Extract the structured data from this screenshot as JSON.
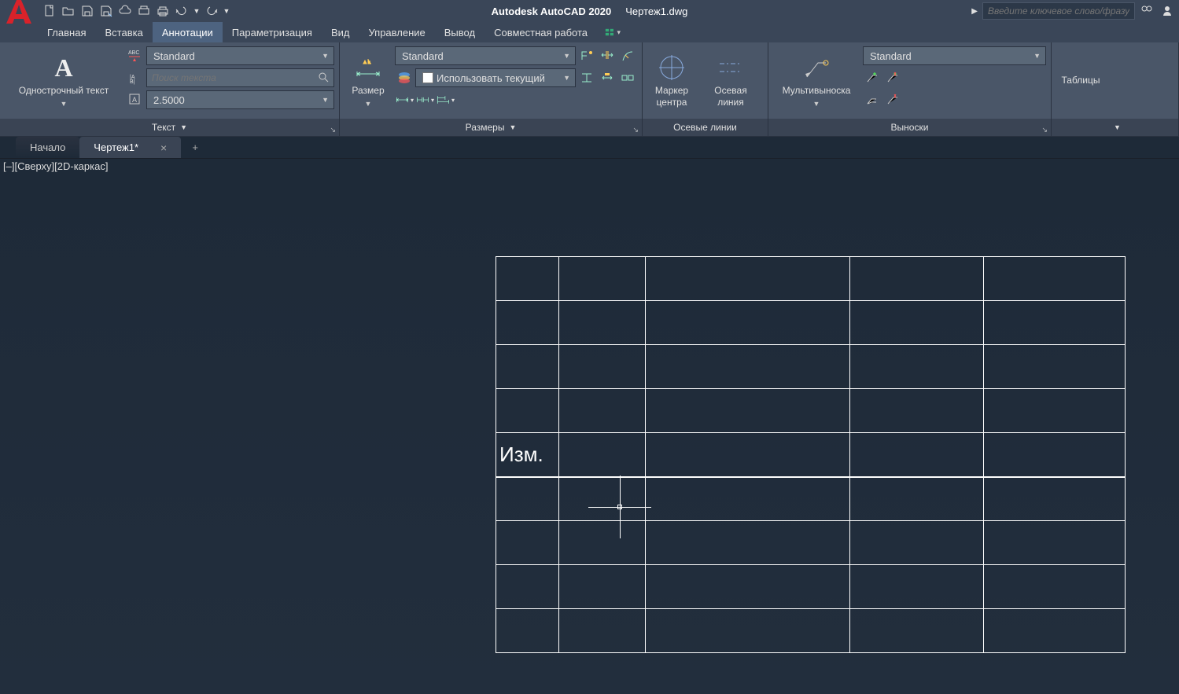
{
  "title": {
    "app": "Autodesk AutoCAD 2020",
    "document": "Чертеж1.dwg"
  },
  "search_help": {
    "placeholder": "Введите ключевое слово/фразу"
  },
  "menu_tabs": [
    {
      "label": "Главная"
    },
    {
      "label": "Вставка"
    },
    {
      "label": "Аннотации"
    },
    {
      "label": "Параметризация"
    },
    {
      "label": "Вид"
    },
    {
      "label": "Управление"
    },
    {
      "label": "Вывод"
    },
    {
      "label": "Совместная работа"
    }
  ],
  "ribbon": {
    "text_panel": {
      "label": "Текст",
      "big_button": "Однострочный текст",
      "style_dropdown": "Standard",
      "search_placeholder": "Поиск текста",
      "height_value": "2.5000"
    },
    "dim_panel": {
      "label": "Размеры",
      "big_button": "Размер",
      "style_dropdown": "Standard",
      "layer_dropdown": "Использовать текущий"
    },
    "center_panel": {
      "label": "Осевые линии",
      "marker": "Маркер центра",
      "centerline": "Осевая линия"
    },
    "leader_panel": {
      "label": "Выноски",
      "big_button": "Мультивыноска",
      "style_dropdown": "Standard"
    },
    "tables_panel": {
      "label": "",
      "big_button": "Таблицы"
    }
  },
  "doc_tabs": {
    "start": "Начало",
    "active": "Чертеж1*"
  },
  "viewport": {
    "label": "[–][Сверху][2D-каркас]"
  },
  "drawing": {
    "cell_text": "Изм."
  }
}
